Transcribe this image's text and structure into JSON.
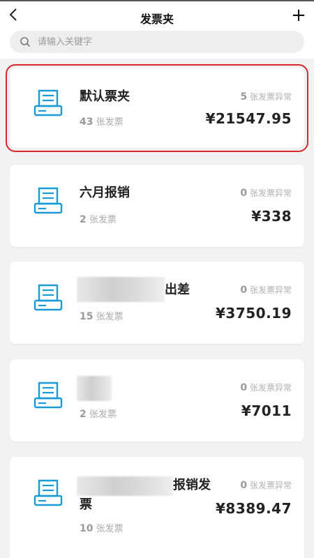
{
  "header": {
    "title": "发票夹",
    "back_icon": "chevron-left-icon",
    "add_label": "+"
  },
  "search": {
    "placeholder": "请输入关键字",
    "value": ""
  },
  "accent": "#1a9ad6",
  "selection_color": "#d9262c",
  "folders": [
    {
      "name": "默认票夹",
      "count_num": "43",
      "count_unit": "张发票",
      "abnormal_num": "5",
      "abnormal_label": "张发票异常",
      "amount": "¥21547.95"
    },
    {
      "name": "六月报销",
      "count_num": "2",
      "count_unit": "张发票",
      "abnormal_num": "0",
      "abnormal_label": "张发票异常",
      "amount": "¥338"
    },
    {
      "name": "出差",
      "count_num": "15",
      "count_unit": "张发票",
      "abnormal_num": "0",
      "abnormal_label": "张发票异常",
      "amount": "¥3750.19"
    },
    {
      "name": "",
      "count_num": "2",
      "count_unit": "张发票",
      "abnormal_num": "0",
      "abnormal_label": "张发票异常",
      "amount": "¥7011"
    },
    {
      "name_line1": "报销发",
      "name_line2": "票",
      "count_num": "10",
      "count_unit": "张发票",
      "abnormal_num": "0",
      "abnormal_label": "张发票异常",
      "amount": "¥8389.47"
    }
  ]
}
